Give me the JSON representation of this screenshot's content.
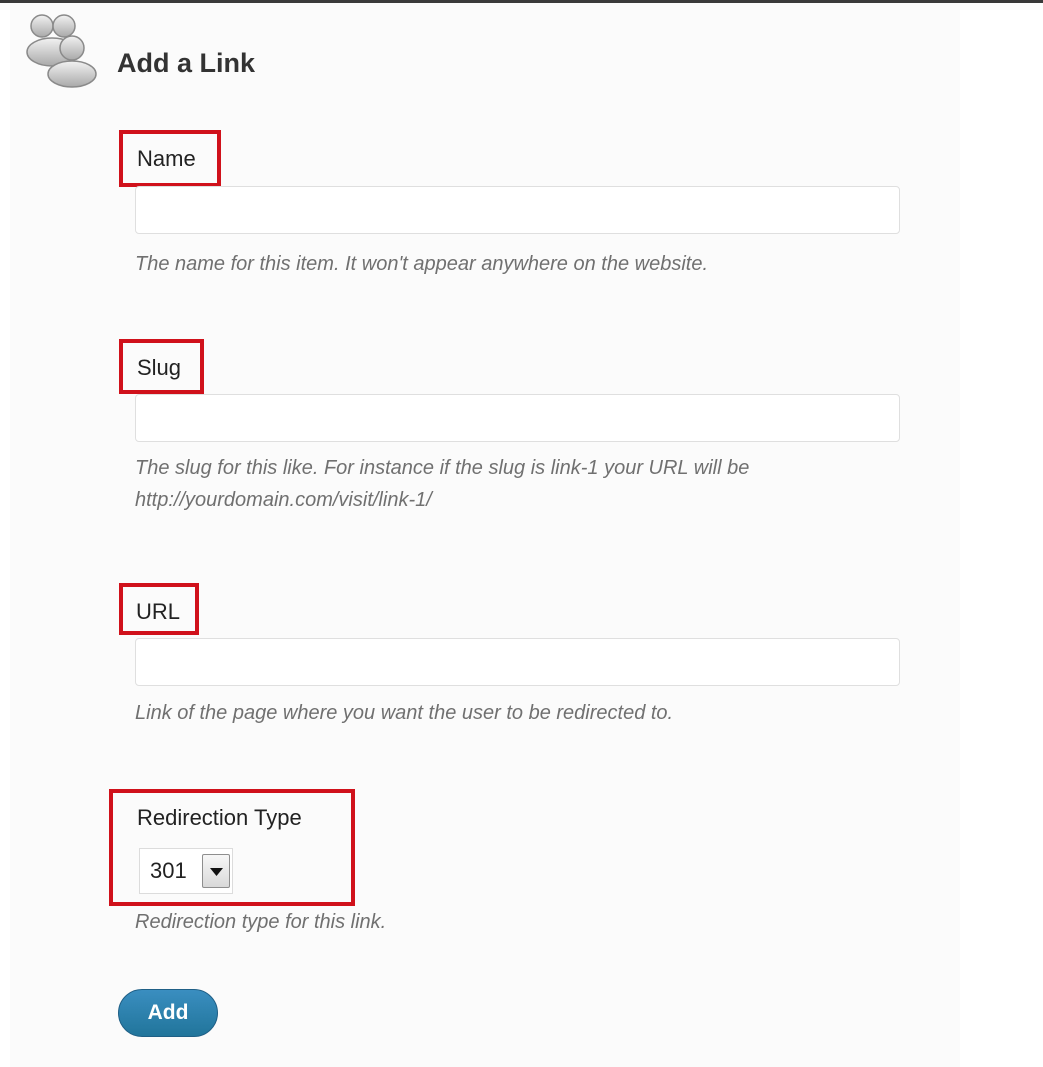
{
  "header": {
    "title": "Add a Link",
    "icon": "users-icon"
  },
  "fields": {
    "name": {
      "label": "Name",
      "value": "",
      "description": "The name for this item. It won't appear anywhere on the website."
    },
    "slug": {
      "label": "Slug",
      "value": "",
      "description": "The slug for this like. For instance if the slug is link-1 your URL will be http://yourdomain.com/visit/link-1/"
    },
    "url": {
      "label": "URL",
      "value": "",
      "description": "Link of the page where you want the user to be redirected to."
    },
    "redirection_type": {
      "label": "Redirection Type",
      "selected": "301",
      "description": "Redirection type for this link."
    }
  },
  "actions": {
    "add_label": "Add"
  },
  "colors": {
    "highlight": "#d0111b",
    "button": "#21759b"
  }
}
